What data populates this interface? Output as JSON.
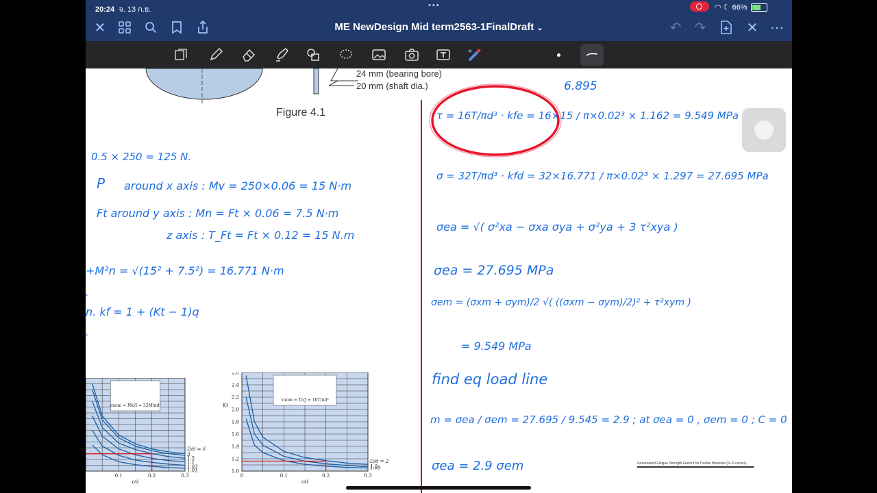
{
  "status": {
    "time": "20:24",
    "date": "จ. 13 ก.ย.",
    "battery": "66%",
    "battery_level": 0.66
  },
  "nav": {
    "title": "ME NewDesign Mid term2563-1FinalDraft"
  },
  "tools": [
    "page-icon",
    "pen-icon",
    "eraser-icon",
    "highlighter-icon",
    "shapes-icon",
    "lasso-icon",
    "image-icon",
    "camera-icon",
    "text-box-icon",
    "laser-pointer-icon"
  ],
  "pdf": {
    "label_bearing": "24 mm (bearing bore)",
    "label_shaft": "20 mm (shaft dia.)",
    "figure": "Figure 4.1"
  },
  "left_notes": [
    "0.5 × 250 = 125 N.",
    "P",
    "around x axis :  Mv = 250×0.06 = 15 N·m",
    "Ft    around y axis :  Mn = Ft × 0.06 = 7.5 N·m",
    "z axis :  T_Ft = Ft × 0.12 = 15 N.m",
    "+M²n  =  √(15² + 7.5²)  =  16.771  N·m",
    ".",
    "n.   kf = 1 + (Kt − 1)q",
    "."
  ],
  "right_notes": [
    "6.895",
    "τ = 16T/πd³ · kfe  =  16×15 / π×0.02³  × 1.162  =  9.549  MPa",
    "σ = 32T/πd³ · kfd  =  32×16.771 / π×0.02³  × 1.297  =  27.695  MPa",
    "σea = √( σ²xa − σxa σya + σ²ya + 3 τ²xya )",
    "σea = 27.695  MPa",
    "σem = (σxm + σym)/2   √( ((σxm − σym)/2)² + τ²xym )",
    "= 9.549  MPa",
    "find  eq  load  line",
    "m =  σea / σem  =  27.695 / 9.545  = 2.9  ;  at  σea = 0 ,  σem = 0 ;  C = 0",
    "σea = 2.9 σem"
  ],
  "bottom_caption": "Generalized Fatigue Strength Factors for Ductile Materials (S–N curves)",
  "chart_data": [
    {
      "type": "line",
      "title": "",
      "xlabel": "r/d",
      "ylabel": "",
      "x_ticks": [
        "0.1",
        "0.2",
        "0.3"
      ],
      "xlim": [
        0,
        0.3
      ],
      "ylim": [
        1.0,
        2.6
      ],
      "inset_formula": "σnom = Mc/I = 32M/πd³",
      "legend": [
        "D/d = 6",
        "3",
        "1.5",
        "1.1",
        "1.03",
        "1.01"
      ],
      "series": [
        {
          "name": "D/d = 6",
          "x": [
            0.02,
            0.05,
            0.1,
            0.15,
            0.2,
            0.25,
            0.3
          ],
          "y": [
            2.5,
            1.95,
            1.62,
            1.47,
            1.38,
            1.33,
            1.3
          ]
        },
        {
          "name": "3",
          "x": [
            0.02,
            0.05,
            0.1,
            0.15,
            0.2,
            0.25,
            0.3
          ],
          "y": [
            2.4,
            1.88,
            1.57,
            1.43,
            1.35,
            1.3,
            1.27
          ]
        },
        {
          "name": "1.5",
          "x": [
            0.02,
            0.05,
            0.1,
            0.15,
            0.2,
            0.25,
            0.3
          ],
          "y": [
            2.2,
            1.75,
            1.48,
            1.37,
            1.3,
            1.25,
            1.22
          ]
        },
        {
          "name": "1.1",
          "x": [
            0.02,
            0.05,
            0.1,
            0.15,
            0.2,
            0.25,
            0.3
          ],
          "y": [
            1.95,
            1.6,
            1.38,
            1.28,
            1.22,
            1.18,
            1.16
          ]
        },
        {
          "name": "1.03",
          "x": [
            0.02,
            0.05,
            0.1,
            0.15,
            0.2,
            0.25,
            0.3
          ],
          "y": [
            1.7,
            1.43,
            1.27,
            1.19,
            1.15,
            1.12,
            1.1
          ]
        },
        {
          "name": "1.01",
          "x": [
            0.02,
            0.05,
            0.1,
            0.15,
            0.2,
            0.25,
            0.3
          ],
          "y": [
            1.45,
            1.28,
            1.16,
            1.11,
            1.08,
            1.06,
            1.05
          ]
        }
      ],
      "markers": {
        "x": 0.2,
        "y": 1.297
      }
    },
    {
      "type": "line",
      "title": "",
      "xlabel": "r/d",
      "ylabel": "Kt",
      "y_ticks": [
        "1.0",
        "1.2",
        "1.4",
        "1.6",
        "1.8",
        "2.0",
        "2.2",
        "2.4",
        "2.6"
      ],
      "x_ticks": [
        "0",
        "0.1",
        "0.2",
        "0.3"
      ],
      "xlim": [
        0,
        0.3
      ],
      "ylim": [
        1.0,
        2.6
      ],
      "inset_formula": "τnom = Tc/J = 16T/πd³",
      "legend": [
        "D/d = 2",
        "1.2",
        "1.09"
      ],
      "series": [
        {
          "name": "D/d = 2",
          "x": [
            0.01,
            0.03,
            0.05,
            0.1,
            0.15,
            0.2,
            0.25,
            0.3
          ],
          "y": [
            2.55,
            1.8,
            1.55,
            1.32,
            1.22,
            1.17,
            1.13,
            1.11
          ]
        },
        {
          "name": "1.2",
          "x": [
            0.01,
            0.03,
            0.05,
            0.1,
            0.15,
            0.2,
            0.25,
            0.3
          ],
          "y": [
            2.2,
            1.6,
            1.42,
            1.24,
            1.16,
            1.12,
            1.09,
            1.07
          ]
        },
        {
          "name": "1.09",
          "x": [
            0.01,
            0.03,
            0.05,
            0.1,
            0.15,
            0.2,
            0.25,
            0.3
          ],
          "y": [
            1.85,
            1.42,
            1.3,
            1.17,
            1.11,
            1.08,
            1.06,
            1.05
          ]
        }
      ],
      "markers": {
        "x": 0.2,
        "y": 1.162
      }
    }
  ]
}
